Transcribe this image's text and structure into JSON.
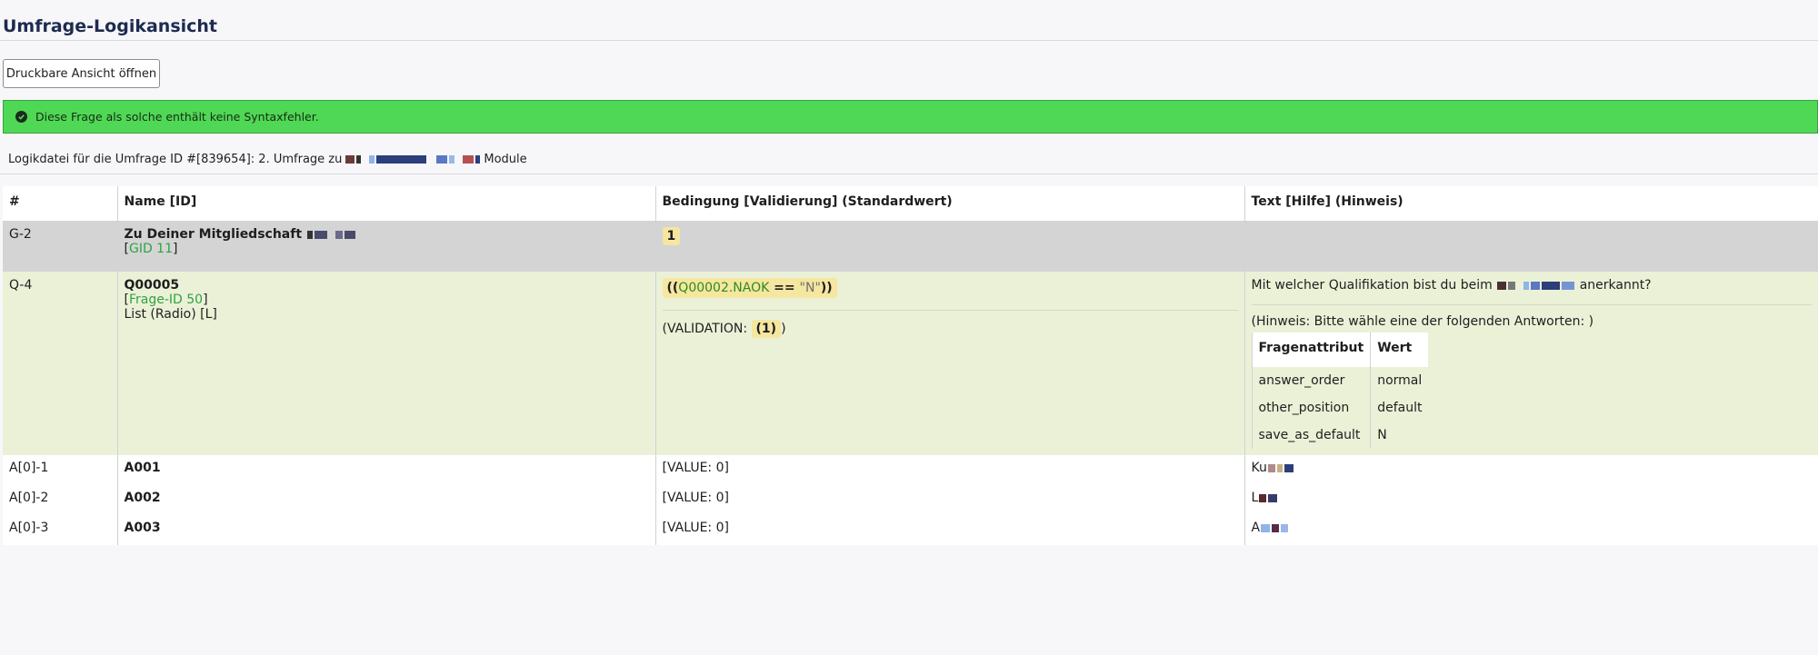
{
  "page_title": "Umfrage-Logikansicht",
  "print_button": "Druckbare Ansicht öffnen",
  "alert": {
    "text": "Diese Frage als solche enthält keine Syntaxfehler.",
    "color": "#4fd856"
  },
  "logfile": {
    "prefix": "Logikdatei für die Umfrage ID #[839654]: 2. Umfrage zu",
    "suffix": "Module"
  },
  "table": {
    "headers": [
      "#",
      "Name [ID]",
      "Bedingung [Validierung] (Standardwert)",
      "Text [Hilfe] (Hinweis)"
    ],
    "group": {
      "num": "G-2",
      "name": "Zu Deiner Mitgliedschaft",
      "gid_open": "[",
      "gid": "GID 11",
      "gid_close": "]",
      "condition": "1"
    },
    "question": {
      "num": "Q-4",
      "code": "Q00005",
      "qid_open": "[",
      "qid": "Frage-ID 50",
      "qid_close": "]",
      "type": "List (Radio) [L]",
      "cond_open": "((",
      "cond_var": "Q00002.NAOK",
      "cond_op": " == ",
      "cond_str": "\"N\"",
      "cond_close": "))",
      "validation_prefix": "(VALIDATION: ",
      "validation_value": "(1)",
      "validation_suffix": ")",
      "text_prefix": "Mit welcher Qualifikation bist du beim",
      "text_suffix": "anerkannt?",
      "hint": "(Hinweis: Bitte wähle eine der folgenden Antworten: )",
      "attr_headers": [
        "Fragenattribut",
        "Wert"
      ],
      "attributes": [
        {
          "name": "answer_order",
          "value": "normal"
        },
        {
          "name": "other_position",
          "value": "default"
        },
        {
          "name": "save_as_default",
          "value": "N"
        }
      ]
    },
    "answers": [
      {
        "num": "A[0]-1",
        "code": "A001",
        "value": "[VALUE: 0]",
        "text": "Ku"
      },
      {
        "num": "A[0]-2",
        "code": "A002",
        "value": "[VALUE: 0]",
        "text": "L"
      },
      {
        "num": "A[0]-3",
        "code": "A003",
        "value": "[VALUE: 0]",
        "text": "A"
      }
    ]
  }
}
